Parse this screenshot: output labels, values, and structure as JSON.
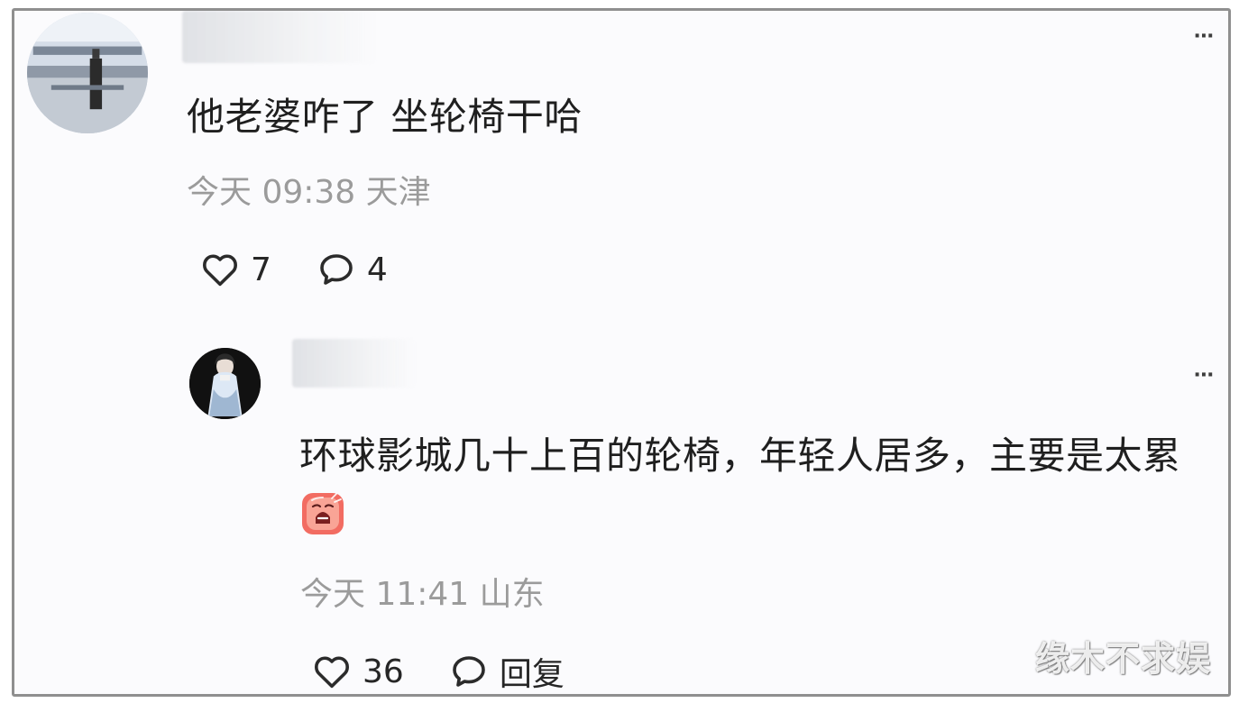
{
  "comments": [
    {
      "text": "他老婆咋了 坐轮椅干哈",
      "time": "今天 09:38",
      "location": "天津",
      "likes": "7",
      "replies": "4"
    },
    {
      "text": "环球影城几十上百的轮椅，年轻人居多，主要是太累",
      "time": "今天 11:41",
      "location": "山东",
      "likes": "36",
      "reply_label": "回复"
    }
  ],
  "icons": {
    "like": "heart-icon",
    "reply": "comment-bubble-icon",
    "more": "more-dots-icon",
    "emoji": "tired-face-emoji"
  },
  "watermark": "缘木不求娱",
  "colors": {
    "primary_text": "#1f1f1f",
    "meta_text": "#9b9b9b",
    "border": "#8f8f8f",
    "background": "#fbfbfd"
  }
}
